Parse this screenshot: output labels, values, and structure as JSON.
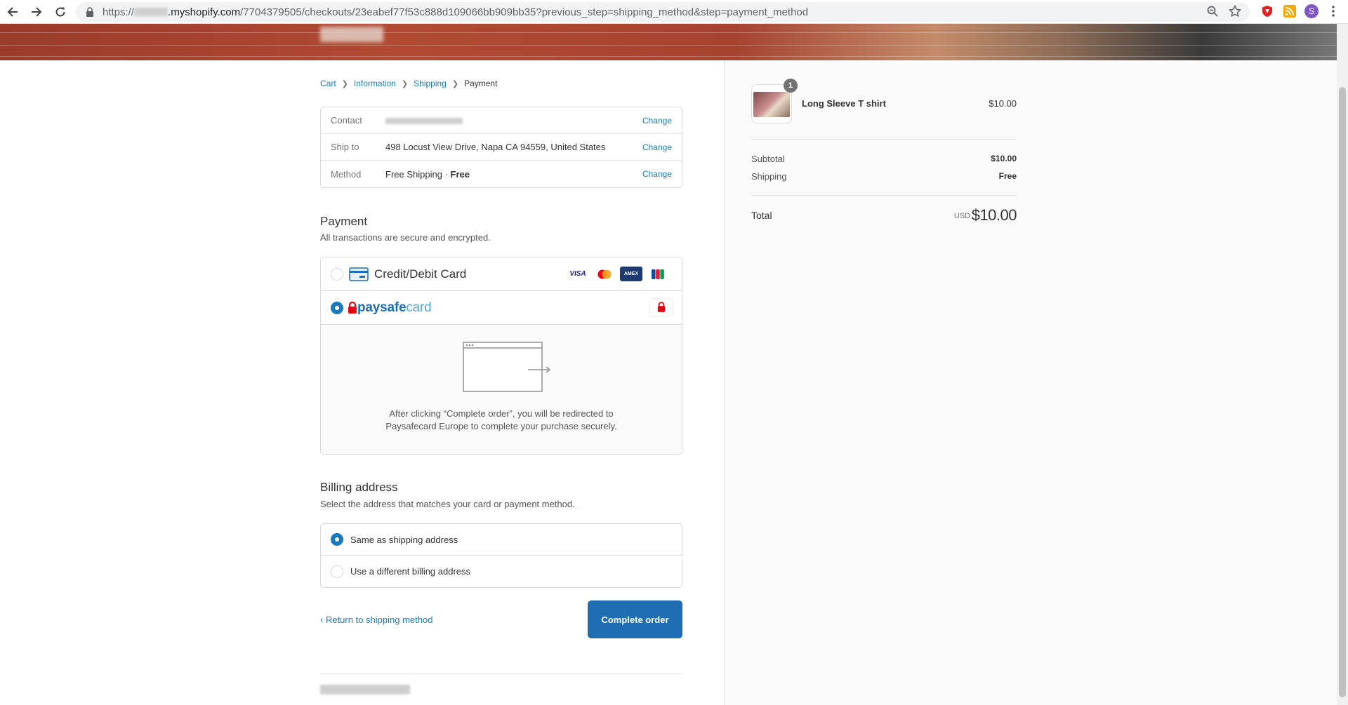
{
  "browser": {
    "url_prefix": "https://",
    "url_host": ".myshopify.com",
    "url_path": "/7704379505/checkouts/23eabef77f53c888d109066bb909bb35?previous_step=shipping_method&step=payment_method",
    "profile_initial": "S"
  },
  "breadcrumb": {
    "cart": "Cart",
    "information": "Information",
    "shipping": "Shipping",
    "payment": "Payment"
  },
  "review": {
    "contact_label": "Contact",
    "ship_label": "Ship to",
    "ship_value": "498 Locust View Drive, Napa CA 94559, United States",
    "method_label": "Method",
    "method_value": "Free Shipping · ",
    "method_value_bold": "Free",
    "change": "Change"
  },
  "payment": {
    "title": "Payment",
    "subtitle": "All transactions are secure and encrypted.",
    "card_label": "Credit/Debit Card",
    "brands": [
      "VISA",
      "mastercard",
      "AMEX",
      "JCB"
    ],
    "paysafe_a": "paysafe",
    "paysafe_b": "card",
    "redirect_line1": "After clicking “Complete order”, you will be redirected to",
    "redirect_line2": "Paysafecard Europe to complete your purchase securely."
  },
  "billing": {
    "title": "Billing address",
    "subtitle": "Select the address that matches your card or payment method.",
    "same": "Same as shipping address",
    "different": "Use a different billing address"
  },
  "actions": {
    "return": "Return to shipping method",
    "complete": "Complete order"
  },
  "summary": {
    "product_name": "Long Sleeve T shirt",
    "product_price": "$10.00",
    "quantity": "1",
    "subtotal_label": "Subtotal",
    "subtotal_value": "$10.00",
    "shipping_label": "Shipping",
    "shipping_value": "Free",
    "total_label": "Total",
    "currency": "USD",
    "total_value": "$10.00"
  },
  "colors": {
    "accent": "#197bbd",
    "button": "#1f6db3",
    "paysafe_red": "#e30613"
  }
}
